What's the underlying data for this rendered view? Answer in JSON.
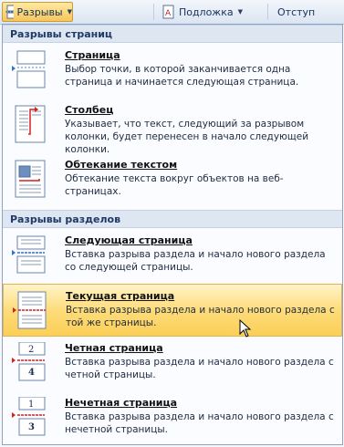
{
  "ribbon": {
    "breaks_label": "Разрывы",
    "watermark_label": "Подложка",
    "indent_label": "Отступ"
  },
  "sections": {
    "page_breaks": "Разрывы страниц",
    "section_breaks": "Разрывы разделов"
  },
  "items": [
    {
      "title": "Страница",
      "desc": "Выбор точки, в которой заканчивается одна страница и начинается следующая страница."
    },
    {
      "title": "Столбец",
      "desc": "Указывает, что текст, следующий за разрывом колонки, будет перенесен в начало следующей колонки."
    },
    {
      "title": "Обтекание текстом",
      "desc": "Обтекание текста вокруг объектов на веб-страницах."
    },
    {
      "title": "Следующая страница",
      "desc": "Вставка разрыва раздела и начало нового раздела со следующей страницы."
    },
    {
      "title": "Текущая страница",
      "desc": "Вставка разрыва раздела и начало нового раздела с той же страницы.",
      "highlighted": true
    },
    {
      "title": "Четная страница",
      "desc": "Вставка разрыва раздела и начало нового раздела с четной страницы.",
      "page_numbers": [
        "2",
        "4"
      ]
    },
    {
      "title": "Нечетная страница",
      "desc": "Вставка разрыва раздела и начало нового раздела с нечетной страницы.",
      "page_numbers": [
        "1",
        "3"
      ]
    }
  ],
  "colors": {
    "highlight": "#fbd25e",
    "accent_red": "#d42020",
    "section_header_bg": "#dde6f1"
  }
}
